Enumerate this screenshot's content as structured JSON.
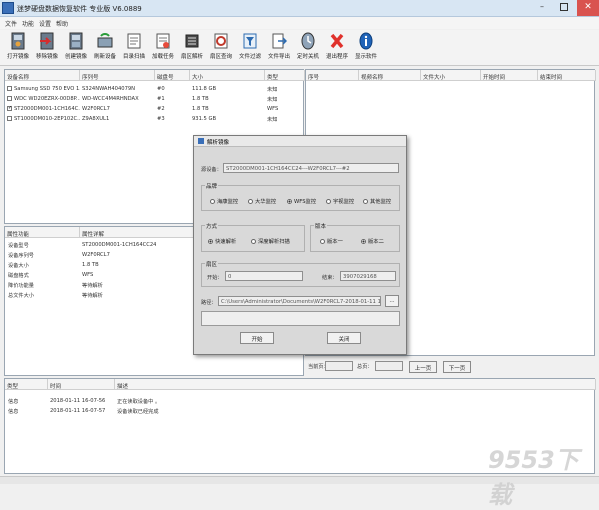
{
  "title": "迷梦硬盘数据恢复软件 专业版 V6.0889",
  "menu": [
    "文件",
    "功能",
    "设置",
    "帮助"
  ],
  "toolbar": [
    {
      "label": "打开镜像",
      "icon": "open-image-icon"
    },
    {
      "label": "移除镜像",
      "icon": "remove-image-icon"
    },
    {
      "label": "创建镜像",
      "icon": "create-image-icon"
    },
    {
      "label": "刷新设备",
      "icon": "refresh-device-icon"
    },
    {
      "label": "目录扫描",
      "icon": "directory-scan-icon"
    },
    {
      "label": "加载任务",
      "icon": "load-task-icon"
    },
    {
      "label": "扇区解析",
      "icon": "sector-parse-icon"
    },
    {
      "label": "扇区查询",
      "icon": "sector-query-icon"
    },
    {
      "label": "文件过滤",
      "icon": "file-filter-icon"
    },
    {
      "label": "文件导出",
      "icon": "file-export-icon"
    },
    {
      "label": "定时关机",
      "icon": "timer-shutdown-icon"
    },
    {
      "label": "退出程序",
      "icon": "exit-icon"
    },
    {
      "label": "显示软件",
      "icon": "info-icon"
    }
  ],
  "devices": {
    "headers": [
      "设备名称",
      "序列号",
      "磁盘号",
      "大小",
      "类型"
    ],
    "rows": [
      {
        "checked": false,
        "name": "Samsung SSD 750 EVO 1...",
        "serial": "S324NWAH404079N",
        "disk": "#0",
        "size": "111.8 GB",
        "type": "未知"
      },
      {
        "checked": false,
        "name": "WDC WD20EZRX-00D8P...",
        "serial": "WD-WCC4M4RHNDAX",
        "disk": "#1",
        "size": "1.8 TB",
        "type": "未知"
      },
      {
        "checked": true,
        "name": "ST2000DM001-1CH164C...",
        "serial": "W2F0RCL7",
        "disk": "#2",
        "size": "1.8 TB",
        "type": "WFS"
      },
      {
        "checked": false,
        "name": "ST1000DM010-2EP102C...",
        "serial": "Z9A8XUL1",
        "disk": "#3",
        "size": "931.5 GB",
        "type": "未知"
      }
    ]
  },
  "files": {
    "headers": [
      "序号",
      "视频名称",
      "文件大小",
      "开始时间",
      "结束时间"
    ]
  },
  "props": {
    "headers": [
      "属性功能",
      "属性详解"
    ],
    "rows": [
      {
        "k": "设备型号",
        "v": "ST2000DM001-1CH164CC24"
      },
      {
        "k": "设备序列号",
        "v": "W2F0RCL7"
      },
      {
        "k": "设备大小",
        "v": "1.8 TB"
      },
      {
        "k": "磁盘格式",
        "v": "WFS"
      },
      {
        "k": "降价功能量",
        "v": "等待解析"
      },
      {
        "k": "总文件大小",
        "v": "等待解析"
      }
    ]
  },
  "pager": {
    "current_label": "当前页：",
    "total_label": "总页：",
    "prev": "上一页",
    "next": "下一页"
  },
  "log": {
    "headers": [
      "类型",
      "时间",
      "描述"
    ],
    "rows": [
      {
        "type": "信息",
        "time": "2018-01-11 16-07-56",
        "desc": "正在读取设备中 。"
      },
      {
        "type": "信息",
        "time": "2018-01-11 16-07-57",
        "desc": "设备读取已经完成"
      }
    ]
  },
  "dialog": {
    "title": "解析镜像",
    "device_label": "源设备：",
    "device_value": "ST2000DM001-1CH164CC24---W2F0RCL7---#2",
    "brand_group": "品牌",
    "brands": [
      {
        "label": "海康监控",
        "selected": false
      },
      {
        "label": "大华监控",
        "selected": false
      },
      {
        "label": "WFS监控",
        "selected": true
      },
      {
        "label": "宇视监控",
        "selected": false
      },
      {
        "label": "其他监控",
        "selected": false
      }
    ],
    "mode_group": "方式",
    "modes": [
      {
        "label": "快速解析",
        "selected": true
      },
      {
        "label": "深度解析扫描",
        "selected": false
      }
    ],
    "version_group": "版本",
    "versions": [
      {
        "label": "版本一",
        "selected": false
      },
      {
        "label": "版本二",
        "selected": true
      }
    ],
    "sector_group": "扇区",
    "start_label": "开始：",
    "start_value": "0",
    "end_label": "结束：",
    "end_value": "3907029168",
    "path_label": "路径：",
    "path_value": "C:\\Users\\Administrator\\Documents\\W2F0RCL7-2018-01-11 16-08-02.tsk",
    "browse": "...",
    "start_btn": "开始",
    "close_btn": "关闭"
  },
  "watermark": "9553下载"
}
